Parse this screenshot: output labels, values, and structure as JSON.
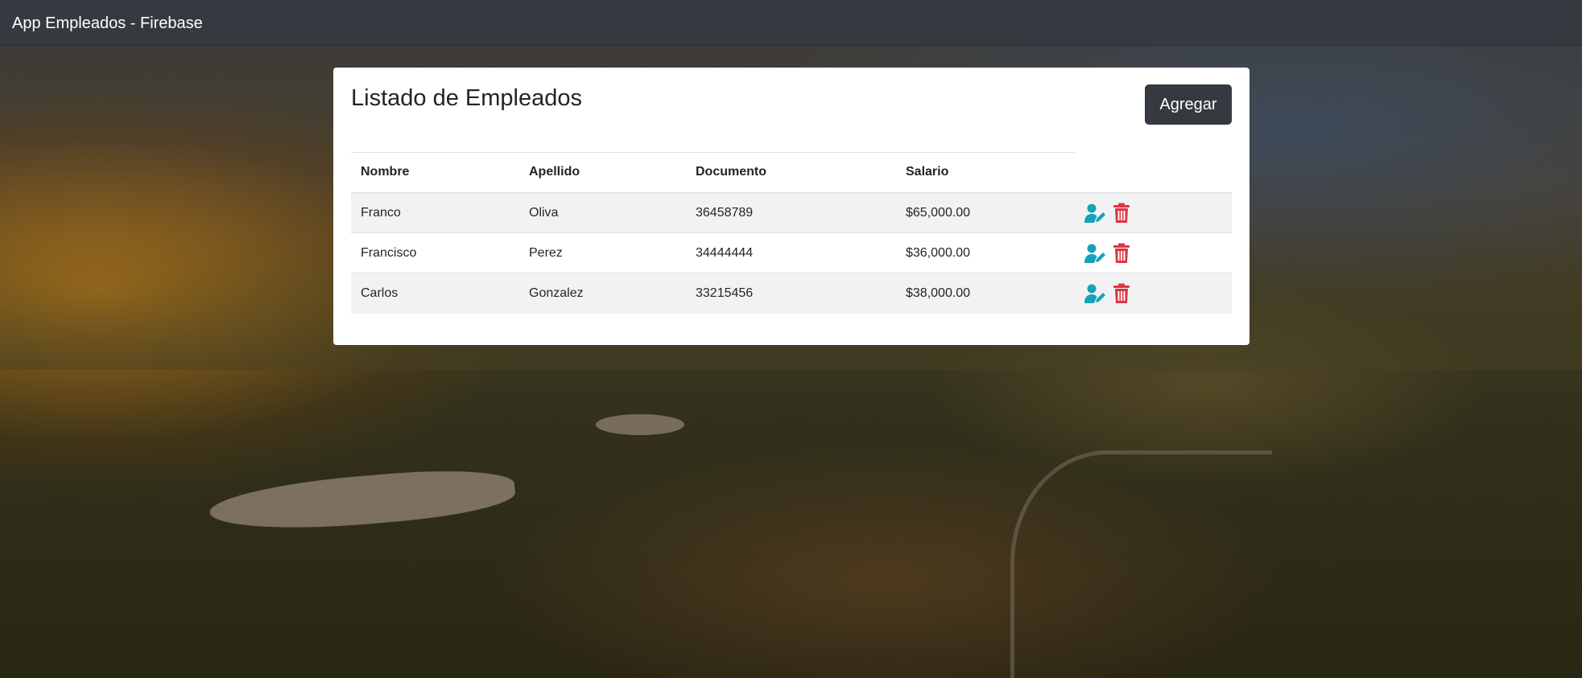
{
  "navbar": {
    "brand": "App Empleados - Firebase"
  },
  "card": {
    "title": "Listado de Empleados",
    "add_button": "Agregar"
  },
  "table": {
    "headers": [
      "Nombre",
      "Apellido",
      "Documento",
      "Salario"
    ],
    "rows": [
      {
        "nombre": "Franco",
        "apellido": "Oliva",
        "documento": "36458789",
        "salario": "$65,000.00"
      },
      {
        "nombre": "Francisco",
        "apellido": "Perez",
        "documento": "34444444",
        "salario": "$36,000.00"
      },
      {
        "nombre": "Carlos",
        "apellido": "Gonzalez",
        "documento": "33215456",
        "salario": "$38,000.00"
      }
    ],
    "row_actions": [
      {
        "name": "user-edit-icon",
        "color": "#17a2b8"
      },
      {
        "name": "trash-icon",
        "color": "#dc3545"
      }
    ]
  },
  "colors": {
    "navbar": "#343a40",
    "button": "#343a40",
    "edit": "#17a2b8",
    "delete": "#dc3545"
  }
}
